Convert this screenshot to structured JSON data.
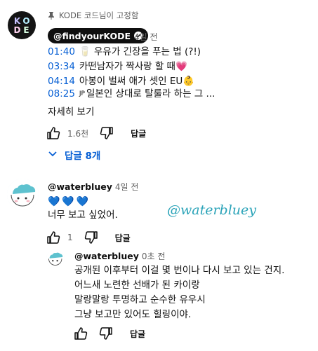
{
  "pinned": {
    "label": "KODE 코드님이 고정함"
  },
  "channel_avatar": {
    "letters": [
      "K",
      "O",
      "D",
      "E"
    ]
  },
  "top_comment": {
    "author": "@findyourKODE",
    "time": "4일 전",
    "lines": [
      {
        "timestamp": "01:40",
        "text": "🥛 우유가 긴장을 푸는 법 (?!)"
      },
      {
        "timestamp": "03:34",
        "text": "카떤남자가 짝사랑 할 때💗"
      },
      {
        "timestamp": "04:14",
        "text": "아봉이 벌써 애가 셋인 EU👶"
      },
      {
        "timestamp": "08:25",
        "prefix": "JP",
        "text": "일본인 상대로 탈룰라 하는 그 ..."
      }
    ],
    "read_more": "자세히 보기",
    "likes": "1.6천",
    "reply_label": "답글",
    "replies_toggle": "답글 8개"
  },
  "reply1": {
    "author": "@waterbluey",
    "time": "4일 전",
    "hearts": "💙💙💙",
    "text": "너무 보고 싶었어.",
    "likes": "1",
    "reply_label": "답글",
    "handwriting": "@waterbluey"
  },
  "reply2": {
    "author": "@waterbluey",
    "time": "0초 전",
    "lines": [
      "공개된 이후부터 이걸 몇 번이나 다시 보고 있는 건지.",
      "어느새 노련한 선배가 된 카이랑",
      "말랑말랑 투명하고 순수한 유우시",
      "그냥 보고만 있어도 힐링이야."
    ],
    "reply_label": "답글"
  },
  "icons": {
    "like": "thumbs-up-icon",
    "dislike": "thumbs-down-icon",
    "pin": "pin-icon",
    "verified": "verified-check-icon",
    "chevron": "chevron-down-icon"
  },
  "colors": {
    "link": "#065fd4",
    "secondary_text": "#606060",
    "chip_bg": "#0f0f0f",
    "handwriting": "#2aa3b8"
  }
}
